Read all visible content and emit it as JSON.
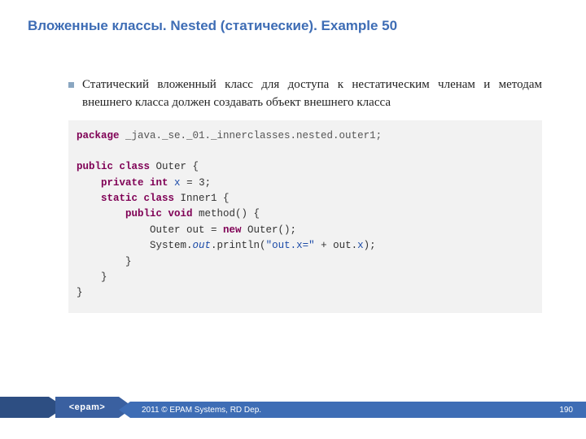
{
  "title": "Вложенные классы. Nested (статические). Example 50",
  "bullet": "Статический вложенный класс для доступа к нестатическим членам и методам внешнего класса должен создавать объект внешнего класса",
  "code": {
    "pkg_kw": "package",
    "pkg_name": " _java._se._01._innerclasses.nested.outer1;",
    "l1a": "public class",
    "l1b": " Outer {",
    "l2a": "    ",
    "l2b": "private int",
    "l2c": " ",
    "l2d": "x",
    "l2e": " = 3;",
    "l3a": "    ",
    "l3b": "static class",
    "l3c": " Inner1 {",
    "l4a": "        ",
    "l4b": "public void",
    "l4c": " method() {",
    "l5a": "            Outer out = ",
    "l5b": "new",
    "l5c": " Outer();",
    "l6a": "            System.",
    "l6b": "out",
    "l6c": ".println(",
    "l6d": "\"out.x=\"",
    "l6e": " + out.",
    "l6f": "x",
    "l6g": ");",
    "l7": "        }",
    "l8": "    }",
    "l9": "}"
  },
  "footer": {
    "logo": "<epam>",
    "copyright": "2011 © EPAM Systems, RD Dep.",
    "page": "190"
  }
}
